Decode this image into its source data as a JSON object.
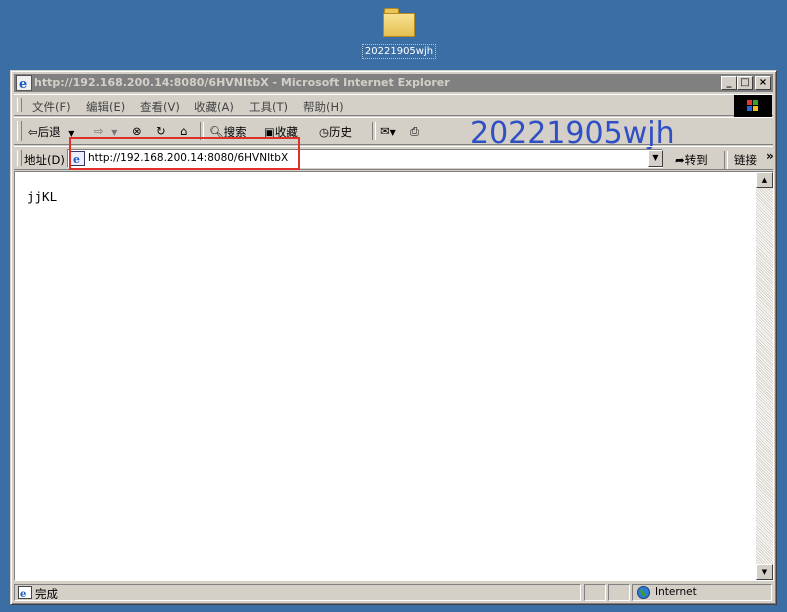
{
  "desktop": {
    "folder_label": "20221905wjh"
  },
  "window": {
    "title": "http://192.168.200.14:8080/6HVNItbX - Microsoft Internet Explorer"
  },
  "menu": [
    "文件(F)",
    "编辑(E)",
    "查看(V)",
    "收藏(A)",
    "工具(T)",
    "帮助(H)"
  ],
  "toolbar": {
    "back": "后退",
    "search": "搜索",
    "favorites": "收藏",
    "history": "历史",
    "watermark": "20221905wjh"
  },
  "address": {
    "label": "地址(D)",
    "url": "http://192.168.200.14:8080/6HVNItbX",
    "go": "转到",
    "links": "链接"
  },
  "page": {
    "text": "jjKL"
  },
  "status": {
    "text": "完成",
    "zone": "Internet"
  },
  "colors": {
    "desktop": "#3a6ea5",
    "annotation": "#e0302a",
    "watermark": "#2f4fc4"
  }
}
